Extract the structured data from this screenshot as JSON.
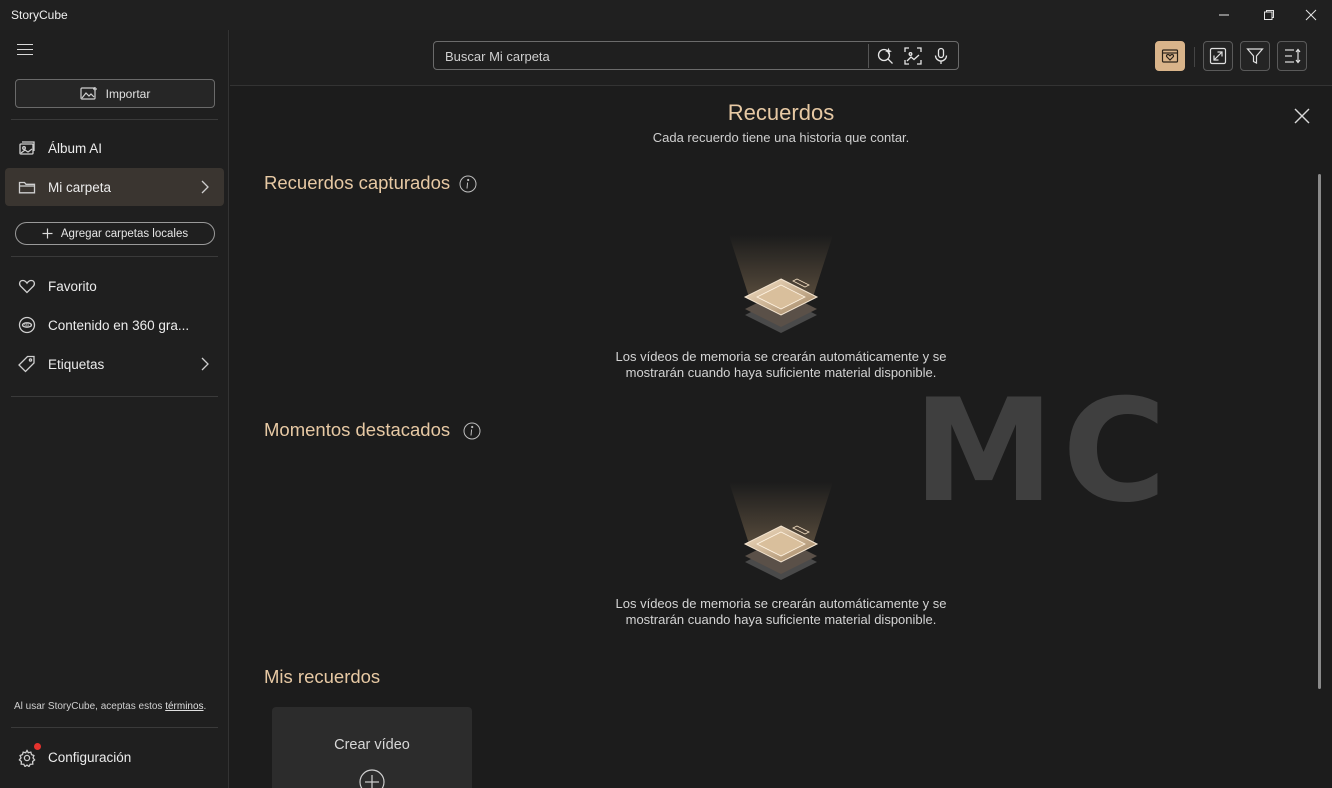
{
  "app": {
    "title": "StoryCube"
  },
  "sidebar": {
    "import_label": "Importar",
    "items": [
      {
        "label": "Álbum AI",
        "icon": "ai-album-icon"
      },
      {
        "label": "Mi carpeta",
        "icon": "folder-icon",
        "active": true
      },
      {
        "label": "Favorito",
        "icon": "heart-icon"
      },
      {
        "label": "Contenido en 360 gra...",
        "icon": "360-icon"
      },
      {
        "label": "Etiquetas",
        "icon": "tag-icon"
      }
    ],
    "add_folders_label": "Agregar carpetas locales",
    "terms_text": "Al usar StoryCube, aceptas estos ",
    "terms_link": "términos",
    "terms_end": ".",
    "settings_label": "Configuración"
  },
  "search": {
    "placeholder": "Buscar Mi carpeta"
  },
  "main": {
    "title": "Recuerdos",
    "subtitle": "Cada recuerdo tiene una historia que contar.",
    "sections": [
      {
        "title": "Recuerdos capturados",
        "empty_line1": "Los vídeos de memoria se crearán automáticamente y se",
        "empty_line2": "mostrarán cuando haya suficiente material disponible."
      },
      {
        "title": "Momentos destacados",
        "empty_line1": "Los vídeos de memoria se crearán automáticamente y se",
        "empty_line2": "mostrarán cuando haya suficiente material disponible."
      },
      {
        "title": "Mis recuerdos"
      }
    ],
    "create_video_label": "Crear vídeo",
    "watermark": "MC"
  },
  "colors": {
    "accent": "#e7c9a4",
    "accent_button": "#d9b48a",
    "background": "#1c1c1c",
    "notification": "#e5322d"
  }
}
